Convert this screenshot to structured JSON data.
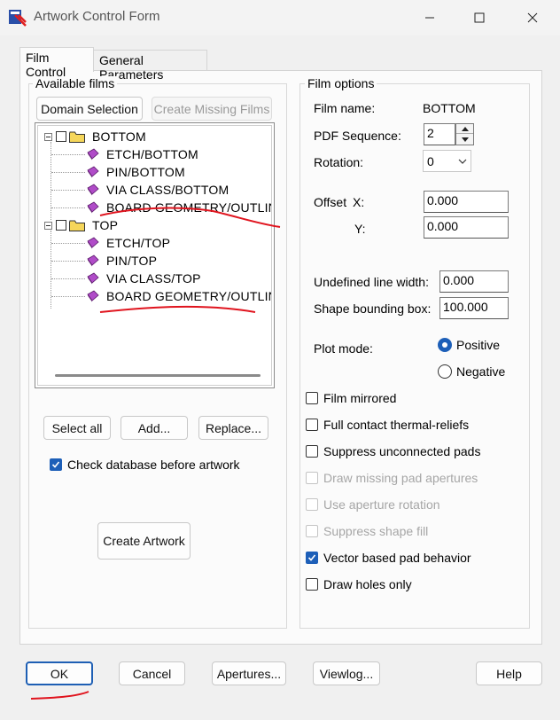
{
  "window": {
    "title": "Artwork Control Form"
  },
  "tabs": [
    {
      "label": "Film Control"
    },
    {
      "label": "General Parameters"
    }
  ],
  "available_films": {
    "group_label": "Available films",
    "domain_selection_label": "Domain Selection",
    "create_missing_label": "Create Missing Films",
    "tree": [
      {
        "label": "BOTTOM",
        "level": 0,
        "type": "folder"
      },
      {
        "label": "ETCH/BOTTOM",
        "level": 1,
        "type": "film"
      },
      {
        "label": "PIN/BOTTOM",
        "level": 1,
        "type": "film"
      },
      {
        "label": "VIA CLASS/BOTTOM",
        "level": 1,
        "type": "film"
      },
      {
        "label": "BOARD GEOMETRY/OUTLINE",
        "level": 1,
        "type": "film"
      },
      {
        "label": "TOP",
        "level": 0,
        "type": "folder"
      },
      {
        "label": "ETCH/TOP",
        "level": 1,
        "type": "film"
      },
      {
        "label": "PIN/TOP",
        "level": 1,
        "type": "film"
      },
      {
        "label": "VIA CLASS/TOP",
        "level": 1,
        "type": "film"
      },
      {
        "label": "BOARD GEOMETRY/OUTLINE",
        "level": 1,
        "type": "film"
      }
    ],
    "select_all_label": "Select all",
    "add_label": "Add...",
    "replace_label": "Replace...",
    "check_database_label": "Check database before artwork",
    "check_database_checked": true,
    "create_artwork_label": "Create Artwork"
  },
  "film_options": {
    "group_label": "Film options",
    "film_name_label": "Film name:",
    "film_name_value": "BOTTOM",
    "pdf_sequence_label": "PDF Sequence:",
    "pdf_sequence_value": "2",
    "rotation_label": "Rotation:",
    "rotation_value": "0",
    "offset_label": "Offset",
    "offset_x_label": "X:",
    "offset_x_value": "0.000",
    "offset_y_label": "Y:",
    "offset_y_value": "0.000",
    "undefined_line_width_label": "Undefined line width:",
    "undefined_line_width_value": "0.000",
    "shape_bounding_box_label": "Shape bounding box:",
    "shape_bounding_box_value": "100.000",
    "plot_mode_label": "Plot mode:",
    "plot_mode_positive": "Positive",
    "plot_mode_negative": "Negative",
    "plot_mode_selected": "Positive",
    "checkboxes": [
      {
        "label": "Film mirrored",
        "checked": false,
        "enabled": true
      },
      {
        "label": "Full contact thermal-reliefs",
        "checked": false,
        "enabled": true
      },
      {
        "label": "Suppress unconnected pads",
        "checked": false,
        "enabled": true
      },
      {
        "label": "Draw missing pad apertures",
        "checked": false,
        "enabled": false
      },
      {
        "label": "Use aperture rotation",
        "checked": false,
        "enabled": false
      },
      {
        "label": "Suppress shape fill",
        "checked": false,
        "enabled": false
      },
      {
        "label": "Vector based pad behavior",
        "checked": true,
        "enabled": true
      },
      {
        "label": "Draw holes only",
        "checked": false,
        "enabled": true
      }
    ]
  },
  "bottom_buttons": {
    "ok": "OK",
    "cancel": "Cancel",
    "apertures": "Apertures...",
    "viewlog": "Viewlog...",
    "help": "Help"
  },
  "colors": {
    "accent": "#1d5fb8",
    "annotation_red": "#e0141e",
    "film_icon": "#b04cc8",
    "folder_yellow": "#f5d65a"
  },
  "icons": {
    "app": "artwork-app-icon",
    "minimize": "minimize-icon",
    "maximize": "maximize-icon",
    "close": "close-icon",
    "folder": "folder-icon",
    "film": "film-icon"
  }
}
